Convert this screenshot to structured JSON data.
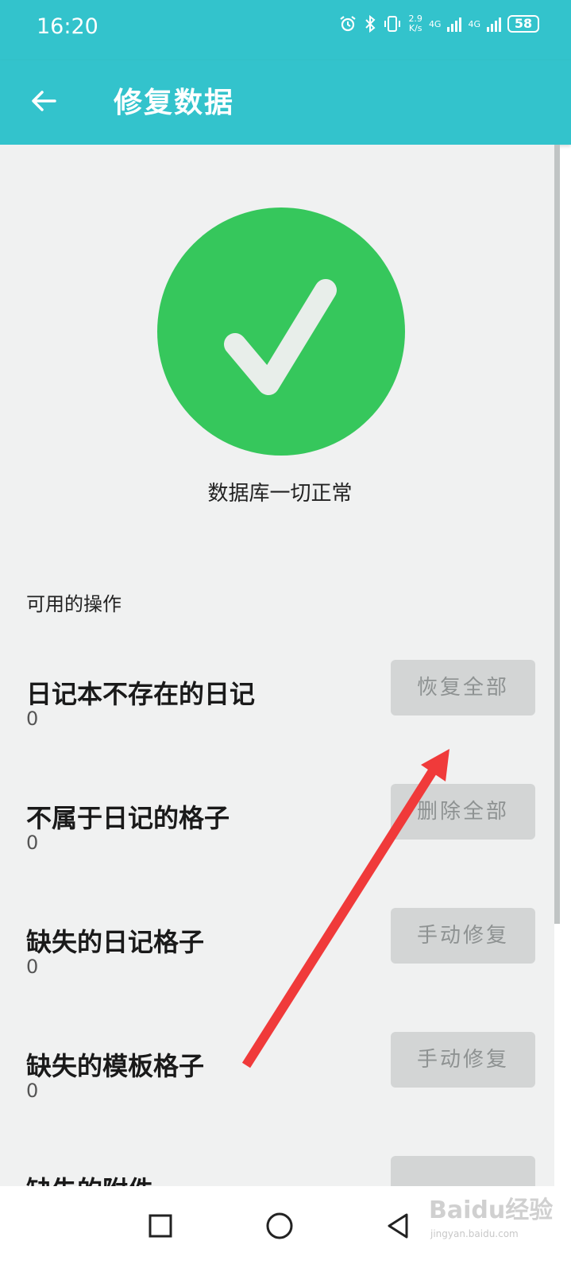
{
  "status_bar": {
    "time": "16:20",
    "icons": [
      "alarm-icon",
      "bluetooth-icon",
      "vibrate-icon"
    ],
    "speed_value": "2.9",
    "speed_unit": "K/s",
    "network_1": "4G",
    "network_2": "4G",
    "battery": "58"
  },
  "app_bar": {
    "title": "修复数据",
    "back_icon": "arrow-left-icon",
    "background": "#33c3cc"
  },
  "database_status": {
    "icon": "check-icon",
    "color": "#36c75c",
    "text": "数据库一切正常"
  },
  "operations": {
    "header": "可用的操作",
    "items": [
      {
        "title": "日记本不存在的日记",
        "count": "0",
        "button": "恢复全部"
      },
      {
        "title": "不属于日记的格子",
        "count": "0",
        "button": "删除全部"
      },
      {
        "title": "缺失的日记格子",
        "count": "0",
        "button": "手动修复"
      },
      {
        "title": "缺失的模板格子",
        "count": "0",
        "button": "手动修复"
      },
      {
        "title": "缺失的附件",
        "count": "",
        "button": ""
      }
    ]
  },
  "annotation": {
    "icon": "red-arrow-icon",
    "color": "#f03a3a"
  },
  "nav_bar": {
    "icons": [
      "square-icon",
      "circle-icon",
      "triangle-back-icon"
    ]
  },
  "watermark": {
    "text": "Baidu经验",
    "sub": "jingyan.baidu.com"
  }
}
